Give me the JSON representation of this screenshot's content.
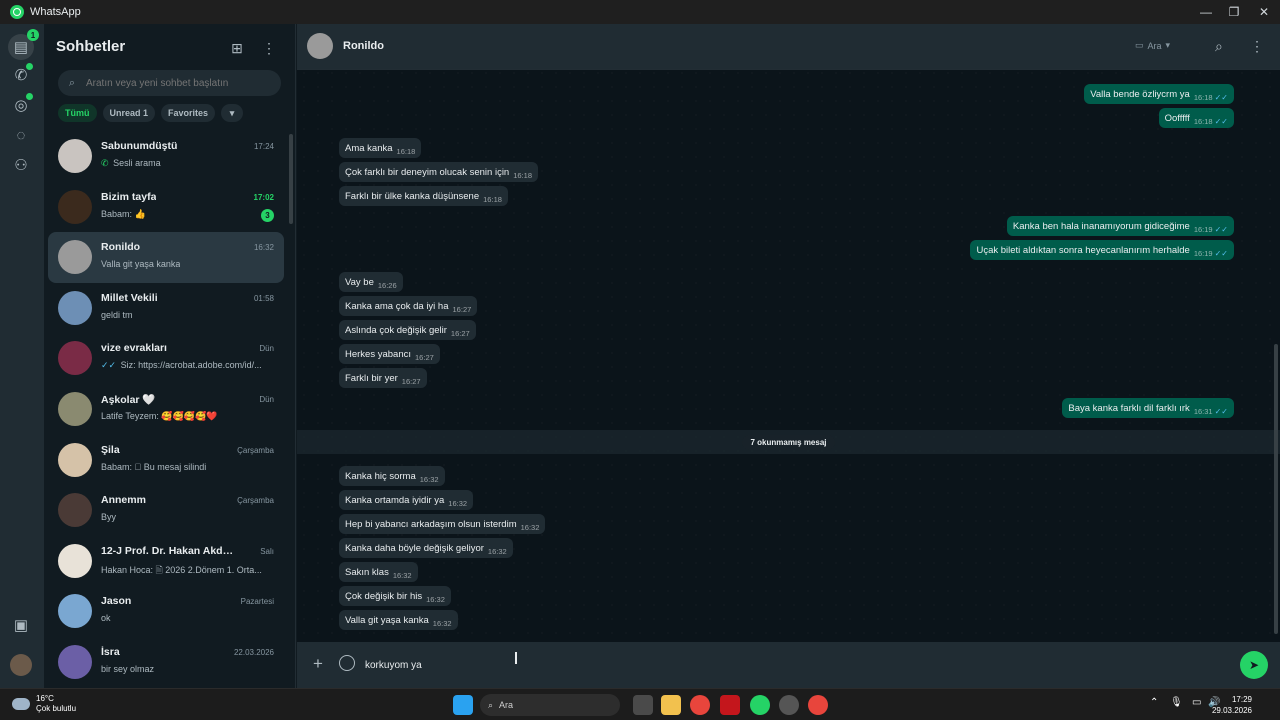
{
  "window": {
    "title": "WhatsApp"
  },
  "rail": {
    "chats_badge": "1"
  },
  "sidebar": {
    "title": "Sohbetler",
    "search_placeholder": "Aratın veya yeni sohbet başlatın",
    "filters": [
      "Tümü",
      "Unread 1",
      "Favorites"
    ],
    "chats": [
      {
        "name": "Sabunumdüştü",
        "time": "17:24",
        "preview": "Sesli arama",
        "icon": "phone-icon",
        "avatar_color": "#c9c4c0"
      },
      {
        "name": "Bizim tayfa",
        "time": "17:02",
        "preview": "Babam: 👍",
        "unread": "3",
        "avatar_color": "#3b2a1d"
      },
      {
        "name": "Ronildo",
        "time": "16:32",
        "preview": "Valla git yaşa kanka",
        "avatar_color": "#9a9a9a"
      },
      {
        "name": "Millet Vekili",
        "time": "01:58",
        "preview": "geldi tm",
        "avatar_color": "#6d8fb5"
      },
      {
        "name": "vize evrakları",
        "time": "Dün",
        "preview": "Siz: https://acrobat.adobe.com/id/...",
        "icon": "double-check-icon",
        "avatar_color": "#7a2b46"
      },
      {
        "name": "Aşkolar 🤍",
        "time": "Dün",
        "preview": "Latife Teyzem: 🥰🥰🥰🥰❤️",
        "avatar_color": "#8a8a70"
      },
      {
        "name": "Şila",
        "time": "Çarşamba",
        "preview": "Babam: ⃠ Bu mesaj silindi",
        "avatar_color": "#d5c2a8"
      },
      {
        "name": "Annemm",
        "time": "Çarşamba",
        "preview": "Byy",
        "avatar_color": "#4a3a36"
      },
      {
        "name": "12-J Prof. Dr. Hakan Akdoğan'ı...",
        "time": "Salı",
        "preview": "Hakan Hoca: 🗎 2026 2.Dönem 1. Orta...",
        "avatar_color": "#e8e2d8"
      },
      {
        "name": "Jason",
        "time": "Pazartesi",
        "preview": "ok",
        "avatar_color": "#7aa7d1"
      },
      {
        "name": "İsra",
        "time": "22.03.2026",
        "preview": "bir sey olmaz",
        "avatar_color": "#6b5fa6"
      }
    ]
  },
  "conversation": {
    "contact": "Ronildo",
    "call_label": "Ara",
    "unread_banner": "7 okunmamış mesaj",
    "composer_value": "korkuyom ya",
    "messages": [
      {
        "dir": "out",
        "text": "Valla bende özliycrm ya",
        "time": "16:18"
      },
      {
        "dir": "out",
        "text": "Oofffff",
        "time": "16:18"
      },
      {
        "dir": "in",
        "text": "Ama kanka",
        "time": "16:18"
      },
      {
        "dir": "in",
        "text": "Çok farklı bir deneyim olucak senin için",
        "time": "16:18"
      },
      {
        "dir": "in",
        "text": "Farklı bir ülke kanka düşünsene",
        "time": "16:18"
      },
      {
        "dir": "out",
        "text": "Kanka ben hala inanamıyorum gidiceğime",
        "time": "16:19"
      },
      {
        "dir": "out",
        "text": "Uçak bileti aldıktan sonra heyecanlanırım herhalde",
        "time": "16:19"
      },
      {
        "dir": "in",
        "text": "Vay be",
        "time": "16:26"
      },
      {
        "dir": "in",
        "text": "Kanka ama çok da iyi ha",
        "time": "16:27"
      },
      {
        "dir": "in",
        "text": "Aslında çok değişik gelir",
        "time": "16:27"
      },
      {
        "dir": "in",
        "text": "Herkes yabancı",
        "time": "16:27"
      },
      {
        "dir": "in",
        "text": "Farklı bir yer",
        "time": "16:27"
      },
      {
        "dir": "out",
        "text": "Baya kanka farklı dil farklı ırk",
        "time": "16:31"
      },
      {
        "dir": "in",
        "text": "Kanka hiç sorma",
        "time": "16:32"
      },
      {
        "dir": "in",
        "text": "Kanka ortamda iyidir ya",
        "time": "16:32"
      },
      {
        "dir": "in",
        "text": "Hep bi yabancı arkadaşım olsun isterdim",
        "time": "16:32"
      },
      {
        "dir": "in",
        "text": "Kanka daha böyle değişik geliyor",
        "time": "16:32"
      },
      {
        "dir": "in",
        "text": "Sakın klas",
        "time": "16:32"
      },
      {
        "dir": "in",
        "text": "Çok değişik bir his",
        "time": "16:32"
      },
      {
        "dir": "in",
        "text": "Valla git yaşa kanka",
        "time": "16:32"
      }
    ]
  },
  "taskbar": {
    "weather_temp": "16°C",
    "weather_desc": "Çok bulutlu",
    "search_label": "Ara",
    "time": "17:29",
    "date": "29.03.2026"
  }
}
